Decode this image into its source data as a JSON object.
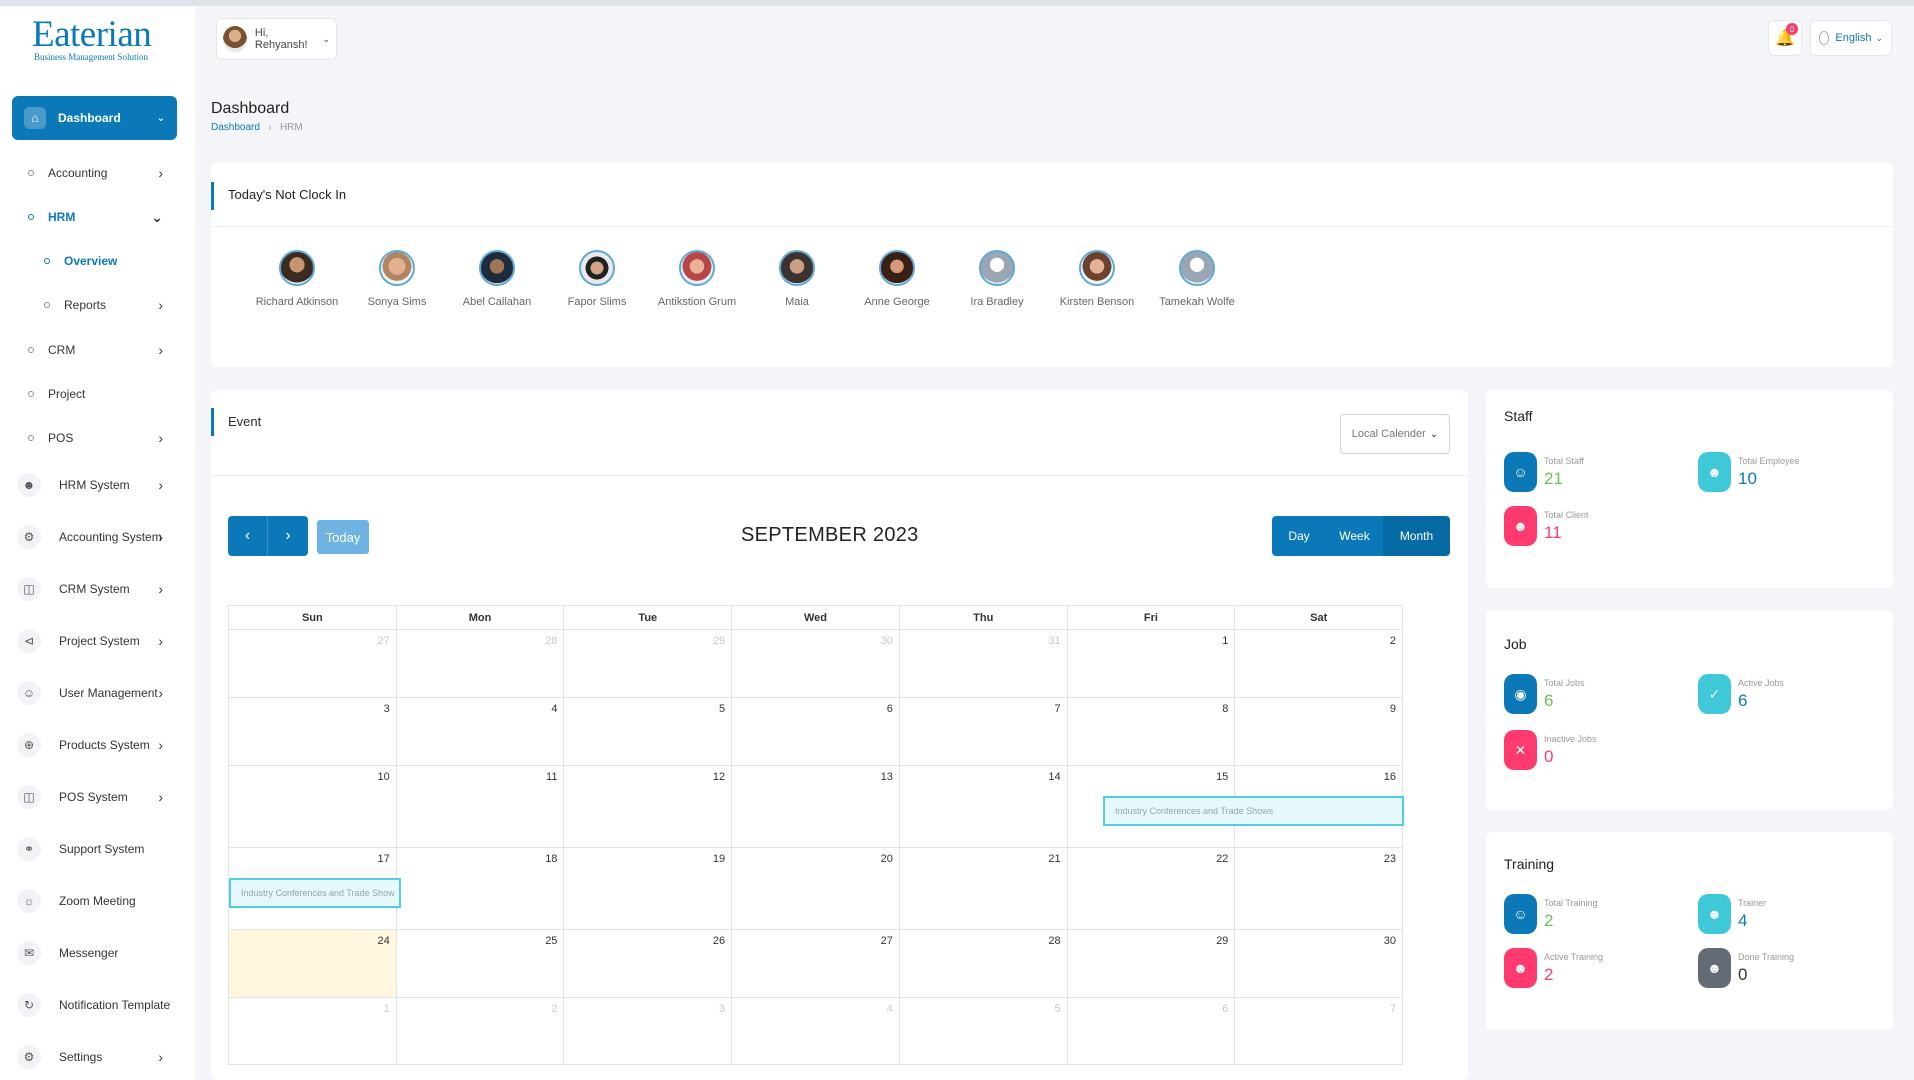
{
  "brand": {
    "title": "Eaterian",
    "subtitle": "Business Management Solution"
  },
  "header": {
    "greeting": "Hi, Rehyansh!",
    "notification_count": "0",
    "language": "English"
  },
  "sidebar": {
    "dashboard": "Dashboard",
    "accounting": "Accounting",
    "hrm": "HRM",
    "overview": "Overview",
    "reports": "Reports",
    "crm": "CRM",
    "project": "Project",
    "pos": "POS",
    "systems": [
      {
        "label": "HRM System",
        "icon": "user-icon"
      },
      {
        "label": "Accounting System",
        "icon": "gear-icon"
      },
      {
        "label": "CRM System",
        "icon": "layers-icon"
      },
      {
        "label": "Project System",
        "icon": "share-icon"
      },
      {
        "label": "User Management",
        "icon": "users-icon"
      },
      {
        "label": "Products System",
        "icon": "cart-icon"
      },
      {
        "label": "POS System",
        "icon": "layers-icon"
      },
      {
        "label": "Support System",
        "icon": "headphones-icon"
      },
      {
        "label": "Zoom Meeting",
        "icon": "user-plus-icon"
      },
      {
        "label": "Messenger",
        "icon": "message-icon"
      },
      {
        "label": "Notification Template",
        "icon": "notification-icon"
      },
      {
        "label": "Settings",
        "icon": "settings-icon"
      }
    ]
  },
  "page": {
    "title": "Dashboard",
    "breadcrumb": [
      "Dashboard",
      "HRM"
    ]
  },
  "not_clock_in": {
    "title": "Today's Not Clock In",
    "people": [
      "Richard Atkinson",
      "Sonya Sims",
      "Abel Callahan",
      "Fapor Slims",
      "Antikstion Grum",
      "Maia",
      "Anne George",
      "Ira Bradley",
      "Kirsten Benson",
      "Tamekah Wolfe"
    ]
  },
  "event": {
    "title": "Event",
    "calendar_select": "Local Calender",
    "today_label": "Today",
    "month_title": "SEPTEMBER 2023",
    "views": [
      "Day",
      "Week",
      "Month"
    ],
    "weekdays": [
      "Sun",
      "Mon",
      "Tue",
      "Wed",
      "Thu",
      "Fri",
      "Sat"
    ],
    "weeks": [
      [
        "27",
        "28",
        "29",
        "30",
        "31",
        "1",
        "2"
      ],
      [
        "3",
        "4",
        "5",
        "6",
        "7",
        "8",
        "9"
      ],
      [
        "10",
        "11",
        "12",
        "13",
        "14",
        "15",
        "16"
      ],
      [
        "17",
        "18",
        "19",
        "20",
        "21",
        "22",
        "23"
      ],
      [
        "24",
        "25",
        "26",
        "27",
        "28",
        "29",
        "30"
      ],
      [
        "1",
        "2",
        "3",
        "4",
        "5",
        "6",
        "7"
      ]
    ],
    "event_label_1": "Industry Conferences and Trade Shows",
    "event_label_2": "Industry Conferences and Trade Show"
  },
  "staff": {
    "title": "Staff",
    "items": [
      {
        "label": "Total Staff",
        "value": "21"
      },
      {
        "label": "Total Employee",
        "value": "10"
      },
      {
        "label": "Total Client",
        "value": "11"
      }
    ]
  },
  "job": {
    "title": "Job",
    "items": [
      {
        "label": "Total Jobs",
        "value": "6"
      },
      {
        "label": "Active Jobs",
        "value": "6"
      },
      {
        "label": "Inactive Jobs",
        "value": "0"
      }
    ]
  },
  "training": {
    "title": "Training",
    "items": [
      {
        "label": "Total Training",
        "value": "2"
      },
      {
        "label": "Trainer",
        "value": "4"
      },
      {
        "label": "Active Training",
        "value": "2"
      },
      {
        "label": "Done Training",
        "value": "0"
      }
    ]
  }
}
